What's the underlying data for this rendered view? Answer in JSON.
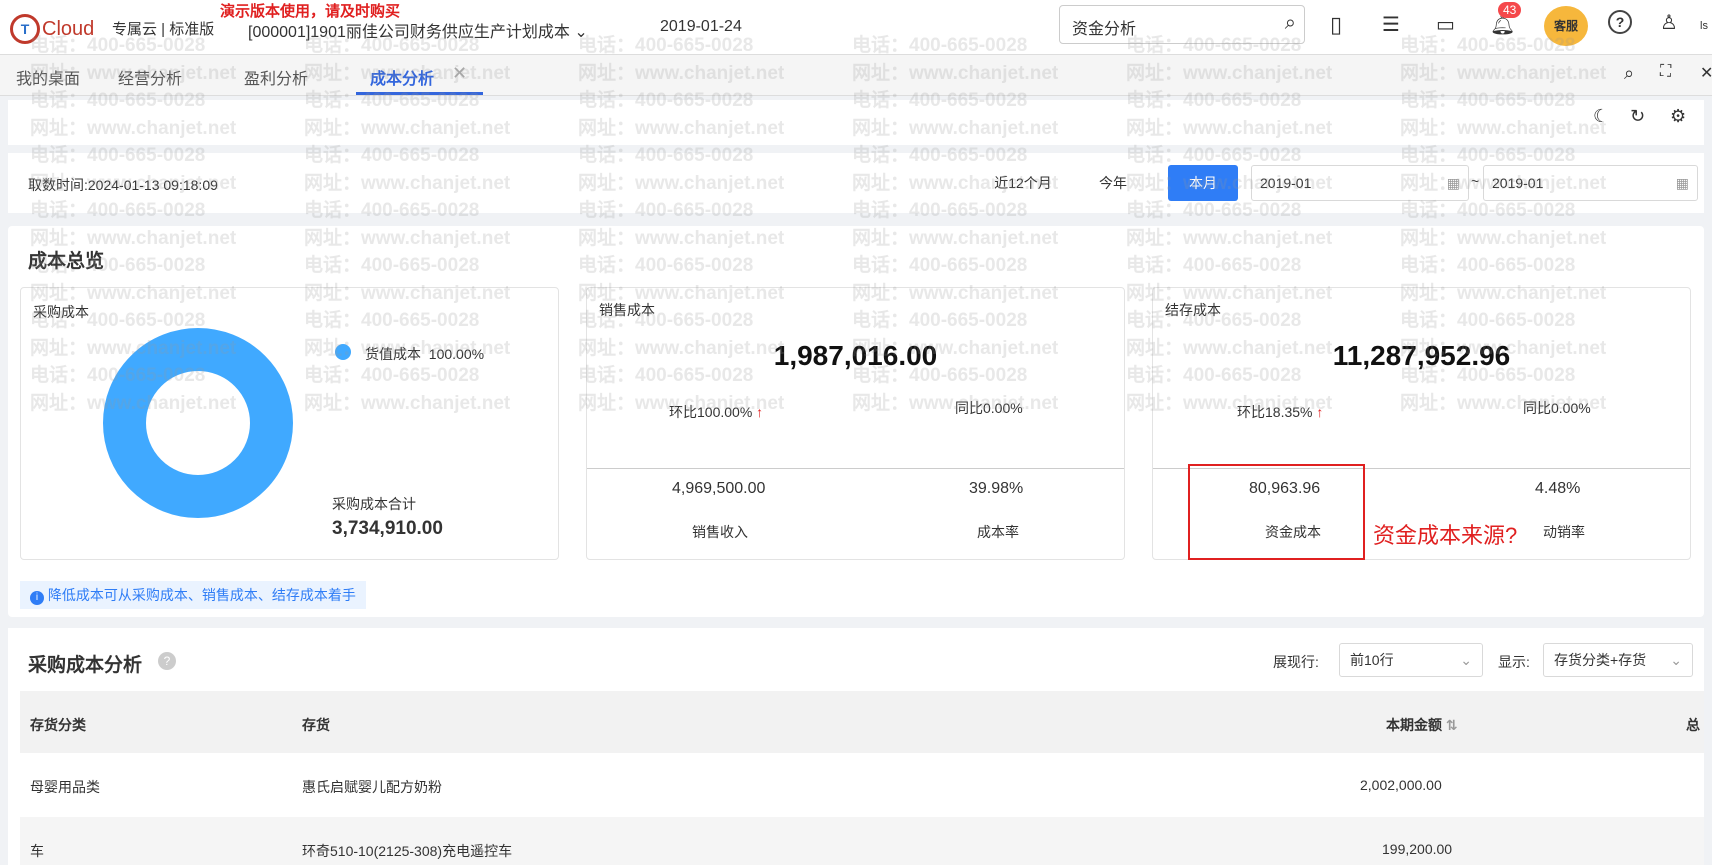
{
  "header": {
    "demo_notice": "演示版本使用，请及时购买",
    "logo_text": "Cloud",
    "edition": "专属云 | 标准版",
    "account": "[000001]1901丽佳公司财务供应生产计划成本",
    "date": "2019-01-24",
    "search_value": "资金分析",
    "notification_count": "43",
    "service_label": "客服",
    "user": "ls"
  },
  "tabs": [
    {
      "label": "我的桌面"
    },
    {
      "label": "经营分析"
    },
    {
      "label": "盈利分析"
    },
    {
      "label": "成本分析"
    }
  ],
  "filter": {
    "fetch_time": "取数时间:2024-01-13 09:18:09",
    "ranges": [
      "近12个月",
      "今年",
      "本月"
    ],
    "start": "2019-01",
    "separator": "~",
    "end": "2019-01"
  },
  "overview": {
    "title": "成本总览",
    "purchase": {
      "title": "采购成本",
      "legend": "货值成本",
      "legend_pct": "100.00%",
      "total_label": "采购成本合计",
      "total": "3,734,910.00",
      "color": "#40a9ff"
    },
    "sales": {
      "title": "销售成本",
      "value": "1,987,016.00",
      "mom": "环比100.00%",
      "yoy": "同比0.00%",
      "income": "4,969,500.00",
      "income_label": "销售收入",
      "rate": "39.98%",
      "rate_label": "成本率"
    },
    "inventory": {
      "title": "结存成本",
      "value": "11,287,952.96",
      "mom": "环比18.35%",
      "yoy": "同比0.00%",
      "capital": "80,963.96",
      "capital_label": "资金成本",
      "rate": "4.48%",
      "rate_label": "动销率"
    },
    "annotation": "资金成本来源?",
    "tip": "降低成本可从采购成本、销售成本、结存成本着手"
  },
  "analysis": {
    "title": "采购成本分析",
    "rows_label": "展现行:",
    "rows_value": "前10行",
    "display_label": "显示:",
    "display_value": "存货分类+存货",
    "columns": [
      "存货分类",
      "存货",
      "本期金额",
      "总"
    ],
    "rows": [
      {
        "category": "母婴用品类",
        "item": "惠氏启赋婴儿配方奶粉",
        "amount": "2,002,000.00"
      },
      {
        "category": "车",
        "item": "环奇510-10(2125-308)充电遥控车",
        "amount": "199,200.00"
      }
    ]
  },
  "watermark": {
    "phone": "电话：400-665-0028",
    "site": "网址：www.chanjet.net"
  }
}
